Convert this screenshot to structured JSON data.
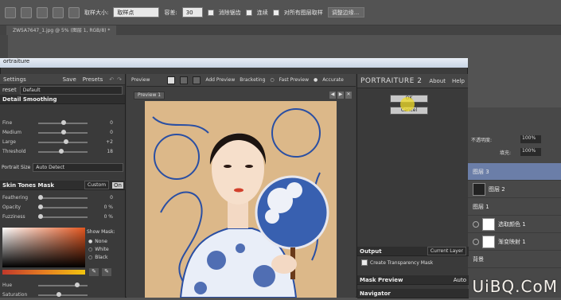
{
  "options_bar": {
    "sample_size_label": "取样大小:",
    "sample_size_value": "取样点",
    "tolerance_label": "容差:",
    "tolerance_value": "30",
    "antialias_label": "消除锯齿",
    "contiguous_label": "连续",
    "sample_all_label": "对所有图层取样",
    "refine_edge_label": "调整边缘..."
  },
  "document_tab": "ZW5A7647_1.jpg @ 5% (图层 1, RGB/8) *",
  "window_title": "ortraiture",
  "left_panel": {
    "settings_label": "Settings",
    "save_label": "Save",
    "presets_label": "Presets",
    "preset_label": "reset",
    "preset_value": "Default",
    "detail_smoothing_label": "Detail Smoothing",
    "sliders": [
      {
        "label": "Fine",
        "value": "0",
        "level": 0.5
      },
      {
        "label": "Medium",
        "value": "0",
        "level": 0.5
      },
      {
        "label": "Large",
        "value": "+2",
        "level": 0.55
      },
      {
        "label": "Threshold",
        "value": "18",
        "level": 0.45
      }
    ],
    "portrait_size_label": "Portrait Size",
    "portrait_size_value": "Auto Detect",
    "skin_mask_label": "Skin Tones Mask",
    "skin_mask_mode": "Custom",
    "skin_mask_toggle": "On",
    "mask_sliders": [
      {
        "label": "Feathering",
        "value": "0",
        "level": 0
      },
      {
        "label": "Opacity",
        "value": "0",
        "unit": "%",
        "level": 0
      },
      {
        "label": "Fuzziness",
        "value": "0",
        "unit": "%",
        "level": 0
      }
    ],
    "show_mask_label": "Show Mask:",
    "show_mask_options": [
      "None",
      "White",
      "Black"
    ],
    "show_mask_selected": "None",
    "bottom_sliders": [
      {
        "label": "Hue",
        "value": "",
        "level": 0.8
      },
      {
        "label": "Saturation",
        "value": "",
        "level": 0.4
      }
    ]
  },
  "center": {
    "preview_label": "Preview",
    "add_preview_label": "Add Preview",
    "bracketing_label": "Bracketing",
    "fast_preview_label": "Fast Preview",
    "accurate_label": "Accurate",
    "preview_tab": "Preview 1"
  },
  "right_panel": {
    "title": "PORTRAITURE 2",
    "about_label": "About",
    "help_label": "Help",
    "ok_label": "OK",
    "cancel_label": "Cancel",
    "output_label": "Output",
    "output_value": "Current Layer",
    "transparency_label": "Create Transparency Mask",
    "mask_preview_label": "Mask Preview",
    "auto_label": "Auto",
    "navigator_label": "Navigator"
  },
  "ps_layers": {
    "opacity_label": "不透明度:",
    "opacity_value": "100%",
    "fill_label": "填充:",
    "fill_value": "100%",
    "layers": [
      "图层 3",
      "图层 2",
      "图层 1",
      "选取颜色 1",
      "渐变映射 1",
      "背景"
    ]
  },
  "watermark": "UiBQ.CoM",
  "colors": {
    "accent_layer": "#6b7ea8",
    "window_bg": "#3c3c3c"
  }
}
